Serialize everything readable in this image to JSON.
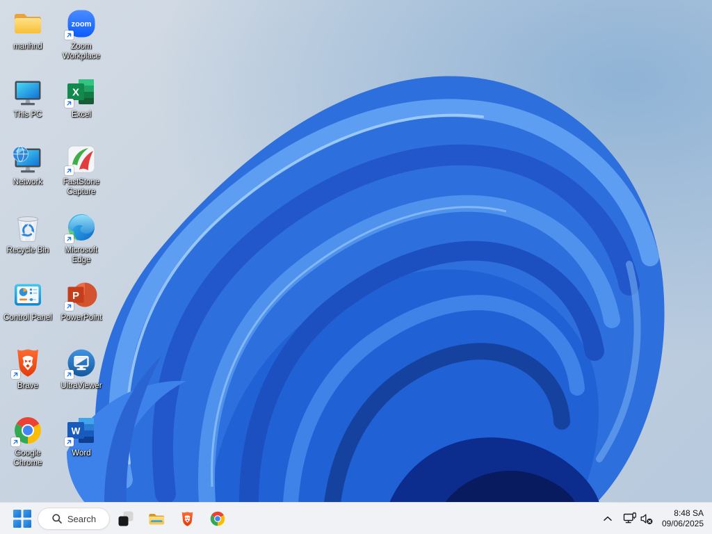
{
  "wallpaper": {
    "name": "windows-11-bloom",
    "base_blue": "#2d6fdd",
    "background_tint": "#c6d2e0"
  },
  "desktop": {
    "icons": [
      {
        "label": "manhnd",
        "type": "folder",
        "shortcut": false
      },
      {
        "label": "Zoom\nWorkplace",
        "type": "zoom",
        "shortcut": true,
        "glyph": "zoom"
      },
      {
        "label": "This PC",
        "type": "this-pc",
        "shortcut": false
      },
      {
        "label": "Excel",
        "type": "excel",
        "shortcut": true,
        "glyph": "X"
      },
      {
        "label": "Network",
        "type": "network",
        "shortcut": false
      },
      {
        "label": "FastStone\nCapture",
        "type": "faststone",
        "shortcut": true
      },
      {
        "label": "Recycle Bin",
        "type": "recycle-bin",
        "shortcut": false
      },
      {
        "label": "Microsoft\nEdge",
        "type": "edge",
        "shortcut": true
      },
      {
        "label": "Control Panel",
        "type": "control-panel",
        "shortcut": false
      },
      {
        "label": "PowerPoint",
        "type": "powerpoint",
        "shortcut": true,
        "glyph": "P"
      },
      {
        "label": "Brave",
        "type": "brave",
        "shortcut": true
      },
      {
        "label": "UltraViewer",
        "type": "ultraviewer",
        "shortcut": true
      },
      {
        "label": "Google\nChrome",
        "type": "chrome",
        "shortcut": true
      },
      {
        "label": "Word",
        "type": "word",
        "shortcut": true,
        "glyph": "W"
      }
    ]
  },
  "taskbar": {
    "search_label": "Search",
    "buttons": [
      "start",
      "search",
      "task-view",
      "file-explorer",
      "brave",
      "chrome"
    ],
    "tray": {
      "time": "8:48 SA",
      "date": "09/06/2025",
      "icons": [
        "chevron-up",
        "network-ethernet",
        "volume-muted"
      ]
    },
    "colors": {
      "taskbar_bg": "#f0f2f6",
      "search_pill": "#ffffff"
    }
  }
}
